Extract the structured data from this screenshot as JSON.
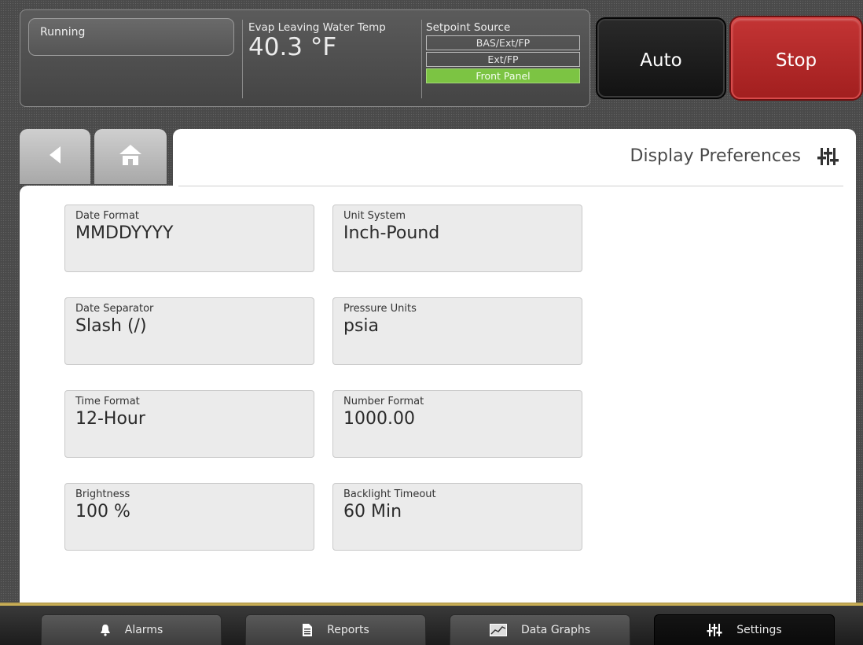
{
  "status": {
    "run_state": "Running",
    "evap_label": "Evap Leaving Water Temp",
    "evap_value": "40.3 °F",
    "setpoint_label": "Setpoint Source",
    "setpoint_options": [
      {
        "label": "BAS/Ext/FP",
        "active": false
      },
      {
        "label": "Ext/FP",
        "active": false
      },
      {
        "label": "Front Panel",
        "active": true
      }
    ]
  },
  "controls": {
    "auto_label": "Auto",
    "stop_label": "Stop"
  },
  "page": {
    "title": "Display Preferences"
  },
  "fields": [
    {
      "label": "Date Format",
      "value": "MMDDYYYY"
    },
    {
      "label": "Unit System",
      "value": "Inch-Pound"
    },
    {
      "label": "Date Separator",
      "value": "Slash (/)"
    },
    {
      "label": "Pressure Units",
      "value": "psia"
    },
    {
      "label": "Time Format",
      "value": "12-Hour"
    },
    {
      "label": "Number Format",
      "value": "1000.00"
    },
    {
      "label": "Brightness",
      "value": "100 %"
    },
    {
      "label": "Backlight Timeout",
      "value": "60 Min"
    }
  ],
  "bottom_nav": [
    {
      "label": "Alarms",
      "icon": "bell-icon",
      "active": false
    },
    {
      "label": "Reports",
      "icon": "document-icon",
      "active": false
    },
    {
      "label": "Data Graphs",
      "icon": "chart-icon",
      "active": false
    },
    {
      "label": "Settings",
      "icon": "sliders-icon",
      "active": true
    }
  ],
  "colors": {
    "stop": "#b52a2a",
    "active_setpoint": "#7cc443",
    "accent_line": "#d8bb58"
  }
}
